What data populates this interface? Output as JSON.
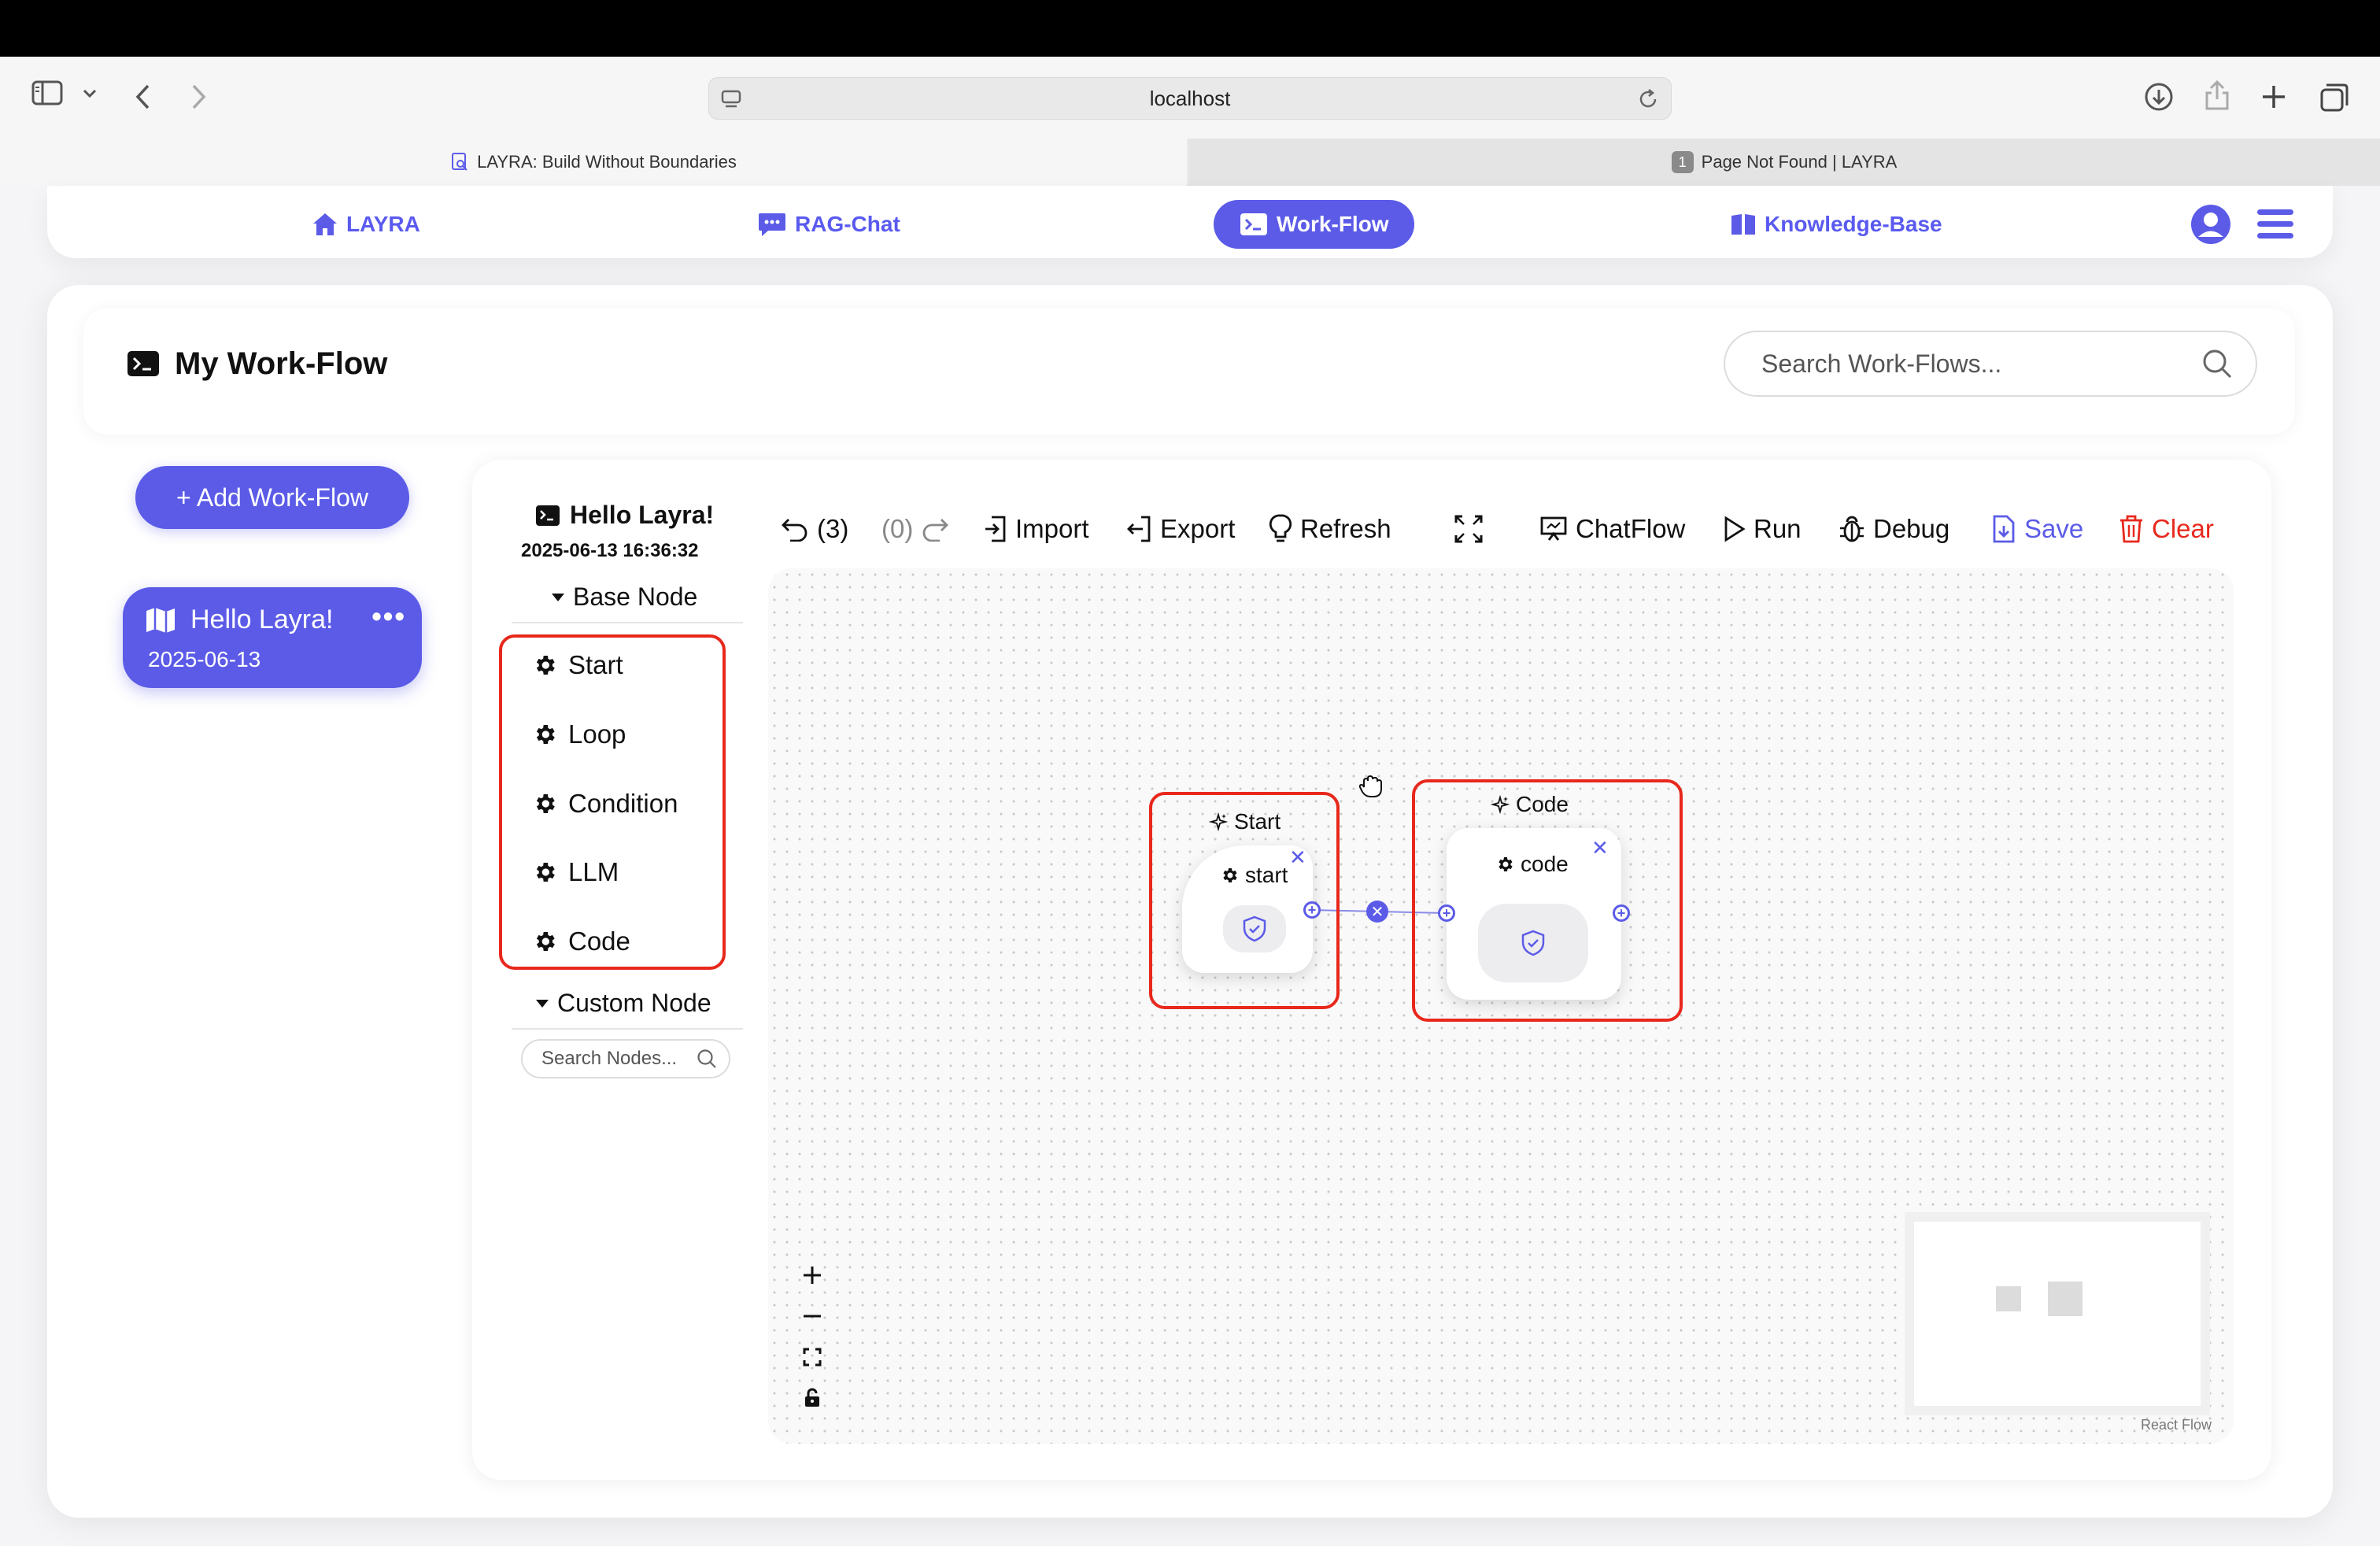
{
  "browser": {
    "url": "localhost",
    "tabs": [
      {
        "title": "LAYRA: Build Without Boundaries",
        "active": true
      },
      {
        "title": "Page Not Found | LAYRA",
        "active": false,
        "badge": "1"
      }
    ]
  },
  "nav": {
    "items": [
      {
        "label": "LAYRA",
        "icon": "home-icon"
      },
      {
        "label": "RAG-Chat",
        "icon": "chat-icon"
      },
      {
        "label": "Work-Flow",
        "icon": "terminal-icon",
        "active": true
      },
      {
        "label": "Knowledge-Base",
        "icon": "book-icon"
      }
    ],
    "accent": "#5b5be8"
  },
  "header": {
    "title": "My Work-Flow",
    "search_placeholder": "Search Work-Flows..."
  },
  "sidebar": {
    "add_label": "+ Add Work-Flow",
    "workflows": [
      {
        "name": "Hello Layra!",
        "date": "2025-06-13"
      }
    ]
  },
  "panel": {
    "workflow_name": "Hello Layra!",
    "workflow_datetime": "2025-06-13 16:36:32",
    "base_node_title": "Base Node",
    "base_nodes": [
      "Start",
      "Loop",
      "Condition",
      "LLM",
      "Code"
    ],
    "custom_node_title": "Custom Node",
    "node_search_placeholder": "Search Nodes..."
  },
  "toolbar": {
    "undo_count": "(3)",
    "redo_count": "(0)",
    "import": "Import",
    "export": "Export",
    "refresh": "Refresh",
    "chatflow": "ChatFlow",
    "run": "Run",
    "debug": "Debug",
    "save": "Save",
    "clear": "Clear"
  },
  "canvas": {
    "nodes": [
      {
        "type_label": "Start",
        "name": "start"
      },
      {
        "type_label": "Code",
        "name": "code"
      }
    ],
    "attribution": "React Flow"
  },
  "colors": {
    "highlight": "#e8281c",
    "accent": "#5b5be8"
  }
}
